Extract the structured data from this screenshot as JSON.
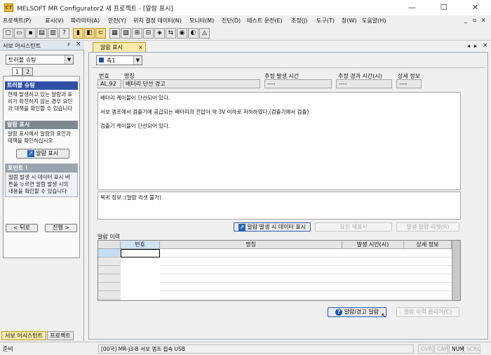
{
  "window": {
    "title": "MELSOFT MR Configurator2 새 프로젝트 - [알람 표시]",
    "app_icon": "CT"
  },
  "menu": [
    "프로젝트(P)",
    "표시(V)",
    "파라미터(A)",
    "안전(Y)",
    "위치 결정 데이터(N)",
    "모니터(M)",
    "진단(D)",
    "테스트 운전(E)",
    "조정(J)",
    "도구(T)",
    "창(W)",
    "도움말(H)"
  ],
  "left_panel": {
    "title": "서보 어시스턴트",
    "pin": "♯",
    "close": "×",
    "combo_value": "트러블 슈팅",
    "tabs": [
      "1",
      "2"
    ],
    "section1_title": "트러블 슈팅",
    "section1_text": "현재 발생하고 있는 알람과 표리가 회전하지 않는 경우 요인과 대책을 확인할 수 있습니다",
    "section2_title": "알람 표시",
    "section2_text": "알람 표시에서 알람의 요인과 대책을 확인하십시오",
    "alarm_display_button": "알람 표시",
    "point_title": "포인트 !",
    "point_text": "알람 발생 시 데이터 표시 버튼을 누르면 알람 발생 시의 내용을 확인할 수 있습니다",
    "back_button": "< 뒤로",
    "next_button": "진행 >",
    "bottom_tabs": [
      "서보 어시스턴트",
      "프로젝트"
    ]
  },
  "document_tab": {
    "label": "알람 표시",
    "close": "×"
  },
  "axis_select": "축1",
  "alarm": {
    "col_no": "번호",
    "col_name": "명칭",
    "col_occurrence_time": "추정 발생 시간",
    "col_elapsed_time": "추정 경과 시간(시)",
    "col_detail": "상세 정보",
    "no": "AL.92",
    "name": "배터리 단선 경고",
    "occurrence_time": "----",
    "elapsed_time": "----",
    "detail": "----",
    "description_lines": [
      "배터리 케이블이 단선되어 있다.",
      "서보 앰프에서 검출기에 공급되는 배터리의 전압이 약 3V 이하로 저하하였다.(검출기에서 검출)",
      "검출기 케이블이 단선되어 있다."
    ],
    "reset_info": "복귀 정보 :(알람 리셋 불가)"
  },
  "buttons": {
    "data_at_alarm": "알람 발생 시 데이터 표시",
    "factor_estimate": "요인 재표시",
    "alarm_reset": "발생 알람 리셋(R)",
    "alarm_help": "알람/경고 일람",
    "history_clear": "알람 이력 클리어(C)"
  },
  "history": {
    "title": "알람 이력",
    "columns": [
      "번호",
      "명칭",
      "발생 시간(시)",
      "상세 정보"
    ]
  },
  "status": {
    "ready": "준비",
    "connection": "[00국] MR-J3-B 서보 앰프 접속 USB",
    "indicators": [
      "OVR",
      "CAP",
      "NUM",
      "SCRL"
    ]
  },
  "colors": {
    "section_blue": "#3050a8",
    "section_gray": "#808890",
    "tab_active": "#fde9a8"
  }
}
